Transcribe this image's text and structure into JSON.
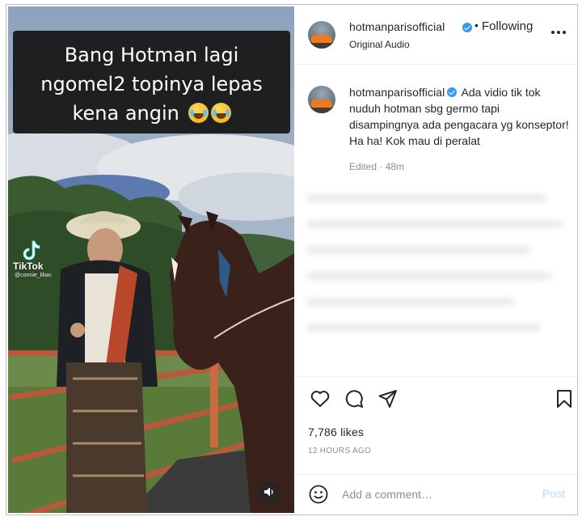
{
  "media": {
    "caption_lines": [
      "Bang Hotman lagi",
      "ngomel2 topinya lepas",
      "kena angin"
    ],
    "tiktok_label": "TikTok",
    "tiktok_user": "@connie_lilian",
    "sound_icon": "volume-icon"
  },
  "header": {
    "username": "hotmanparisofficial",
    "separator": "•",
    "follow_label": "Following",
    "audio": "Original Audio",
    "more_icon": "more-icon"
  },
  "caption": {
    "username": "hotmanparisofficial",
    "text": "Ada vidio tik tok nuduh hotman sbg germo tapi disampingnya ada pengacara yg konseptor! Ha ha! Kok mau di peralat",
    "meta": "Edited · 48m"
  },
  "actions": {
    "icons": [
      "heart-icon",
      "comment-icon",
      "share-icon",
      "bookmark-icon"
    ],
    "likes": "7,786 likes",
    "time_ago": "12 HOURS AGO"
  },
  "comment_bar": {
    "placeholder": "Add a comment…",
    "post_label": "Post",
    "post_color": "#b2dffc"
  },
  "colors": {
    "verified": "#3897f0",
    "text": "#262626",
    "muted": "#8e8e8e"
  }
}
